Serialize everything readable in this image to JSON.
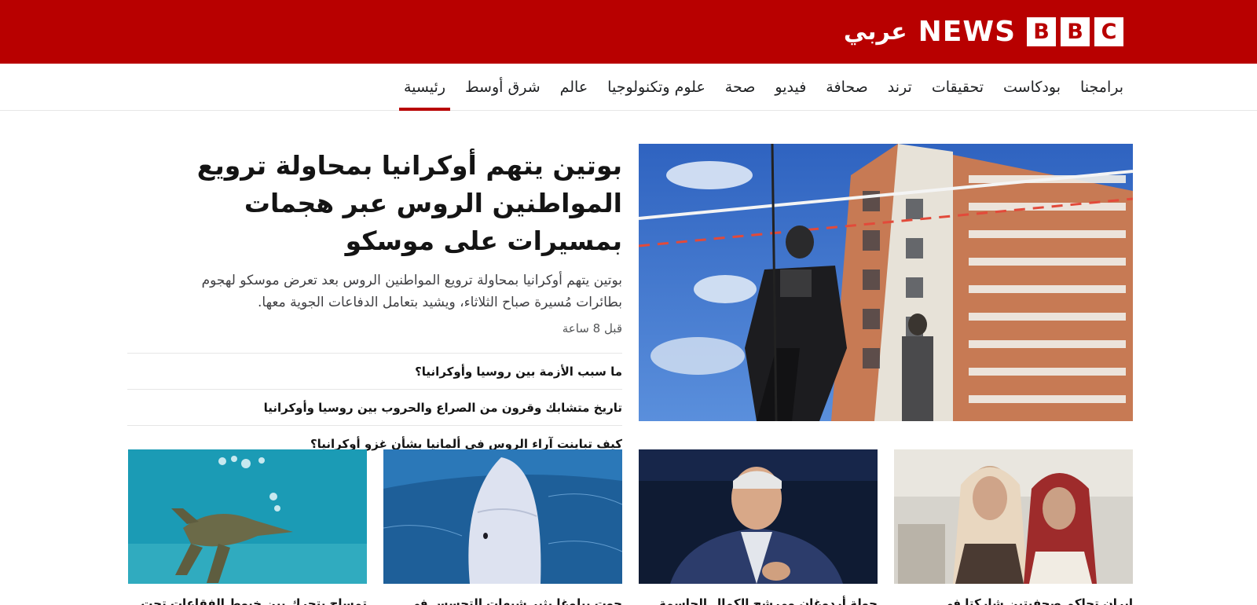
{
  "header": {
    "logo_letters": [
      "B",
      "B",
      "C"
    ],
    "logo_news": "NEWS",
    "logo_service": "عربي",
    "background_color": "#b80000"
  },
  "nav": {
    "items": [
      {
        "label": "رئيسية",
        "active": true
      },
      {
        "label": "شرق أوسط"
      },
      {
        "label": "عالم"
      },
      {
        "label": "علوم وتكنولوجيا"
      },
      {
        "label": "صحة"
      },
      {
        "label": "فيديو"
      },
      {
        "label": "صحافة"
      },
      {
        "label": "ترند"
      },
      {
        "label": "تحقيقات"
      },
      {
        "label": "بودكاست"
      },
      {
        "label": "برامجنا"
      }
    ],
    "active_color": "#b80000"
  },
  "hero": {
    "title": "بوتين يتهم أوكرانيا بمحاولة ترويع المواطنين الروس عبر هجمات بمسيرات على موسكو",
    "summary": "بوتين يتهم أوكرانيا بمحاولة ترويع المواطنين الروس بعد تعرض موسكو لهجوم بطائرات مُسيرة صباح الثلاثاء، ويشيد بتعامل الدفاعات الجوية معها.",
    "timestamp": "قبل 8 ساعة",
    "image_icon": "apartment-building-police-photo",
    "related": [
      "ما سبب الأزمة بين روسيا وأوكرانيا؟",
      "تاريخ متشابك وقرون من الصراع والحروب بين روسيا وأوكرانيا",
      "كيف تباينت آراء الروس في ألمانيا بشأن غزو أوكرانيا؟"
    ]
  },
  "cards": [
    {
      "image_icon": "two-women-headscarves-photo",
      "caption": "إيران تحاكم صحفيتين شاركتا في"
    },
    {
      "image_icon": "erdogan-portrait-photo",
      "caption": "جولة أردوغان ومرشح الكمال الحاسمة"
    },
    {
      "image_icon": "beluga-whale-photo",
      "caption": "حوت بيلوغا يثير شبهات التجسس في"
    },
    {
      "image_icon": "crocodile-underwater-photo",
      "caption": "تمساح يتحرك بين خيوط الفقاعات تحت"
    }
  ]
}
